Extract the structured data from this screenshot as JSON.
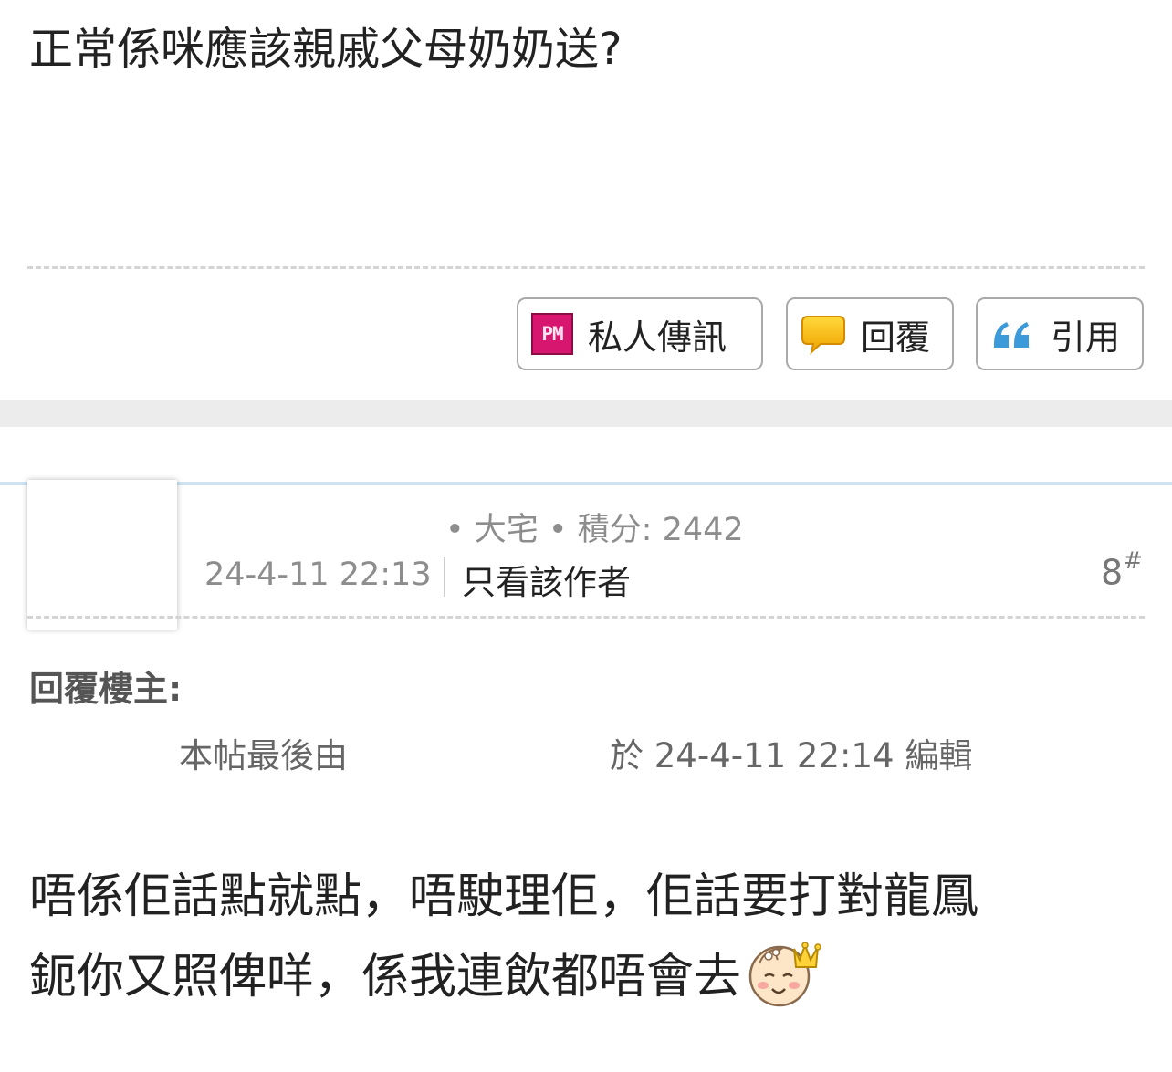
{
  "previous_post": {
    "text": "正常係咪應該親戚父母奶奶送?"
  },
  "actions": {
    "pm_icon": "PM",
    "pm_label": "私人傳訊",
    "reply_label": "回覆",
    "quote_label": "引用"
  },
  "post": {
    "user_meta": "• 大宅 • 積分: 2442",
    "timestamp": "24-4-11 22:13",
    "author_only_link": "只看該作者",
    "floor_number": "8",
    "floor_symbol": "#",
    "reply_to": "回覆樓主:",
    "edit_note_prefix": "本帖最後由",
    "edit_note_suffix": "於 24-4-11 22:14 編輯",
    "body_lines": [
      "唔係佢話點就點，唔駛理佢，佢話要打對龍鳳",
      "鈪你又照俾咩，係我連飲都唔會去"
    ],
    "smiley_icon": "baby-crown-smiley-icon"
  },
  "colors": {
    "pm_badge": "#d6166f",
    "reply_bubble": "#f7b500",
    "quote_mark": "#3d9ad8",
    "blue_rule": "#cfe4f3",
    "section_band": "#ececec"
  }
}
